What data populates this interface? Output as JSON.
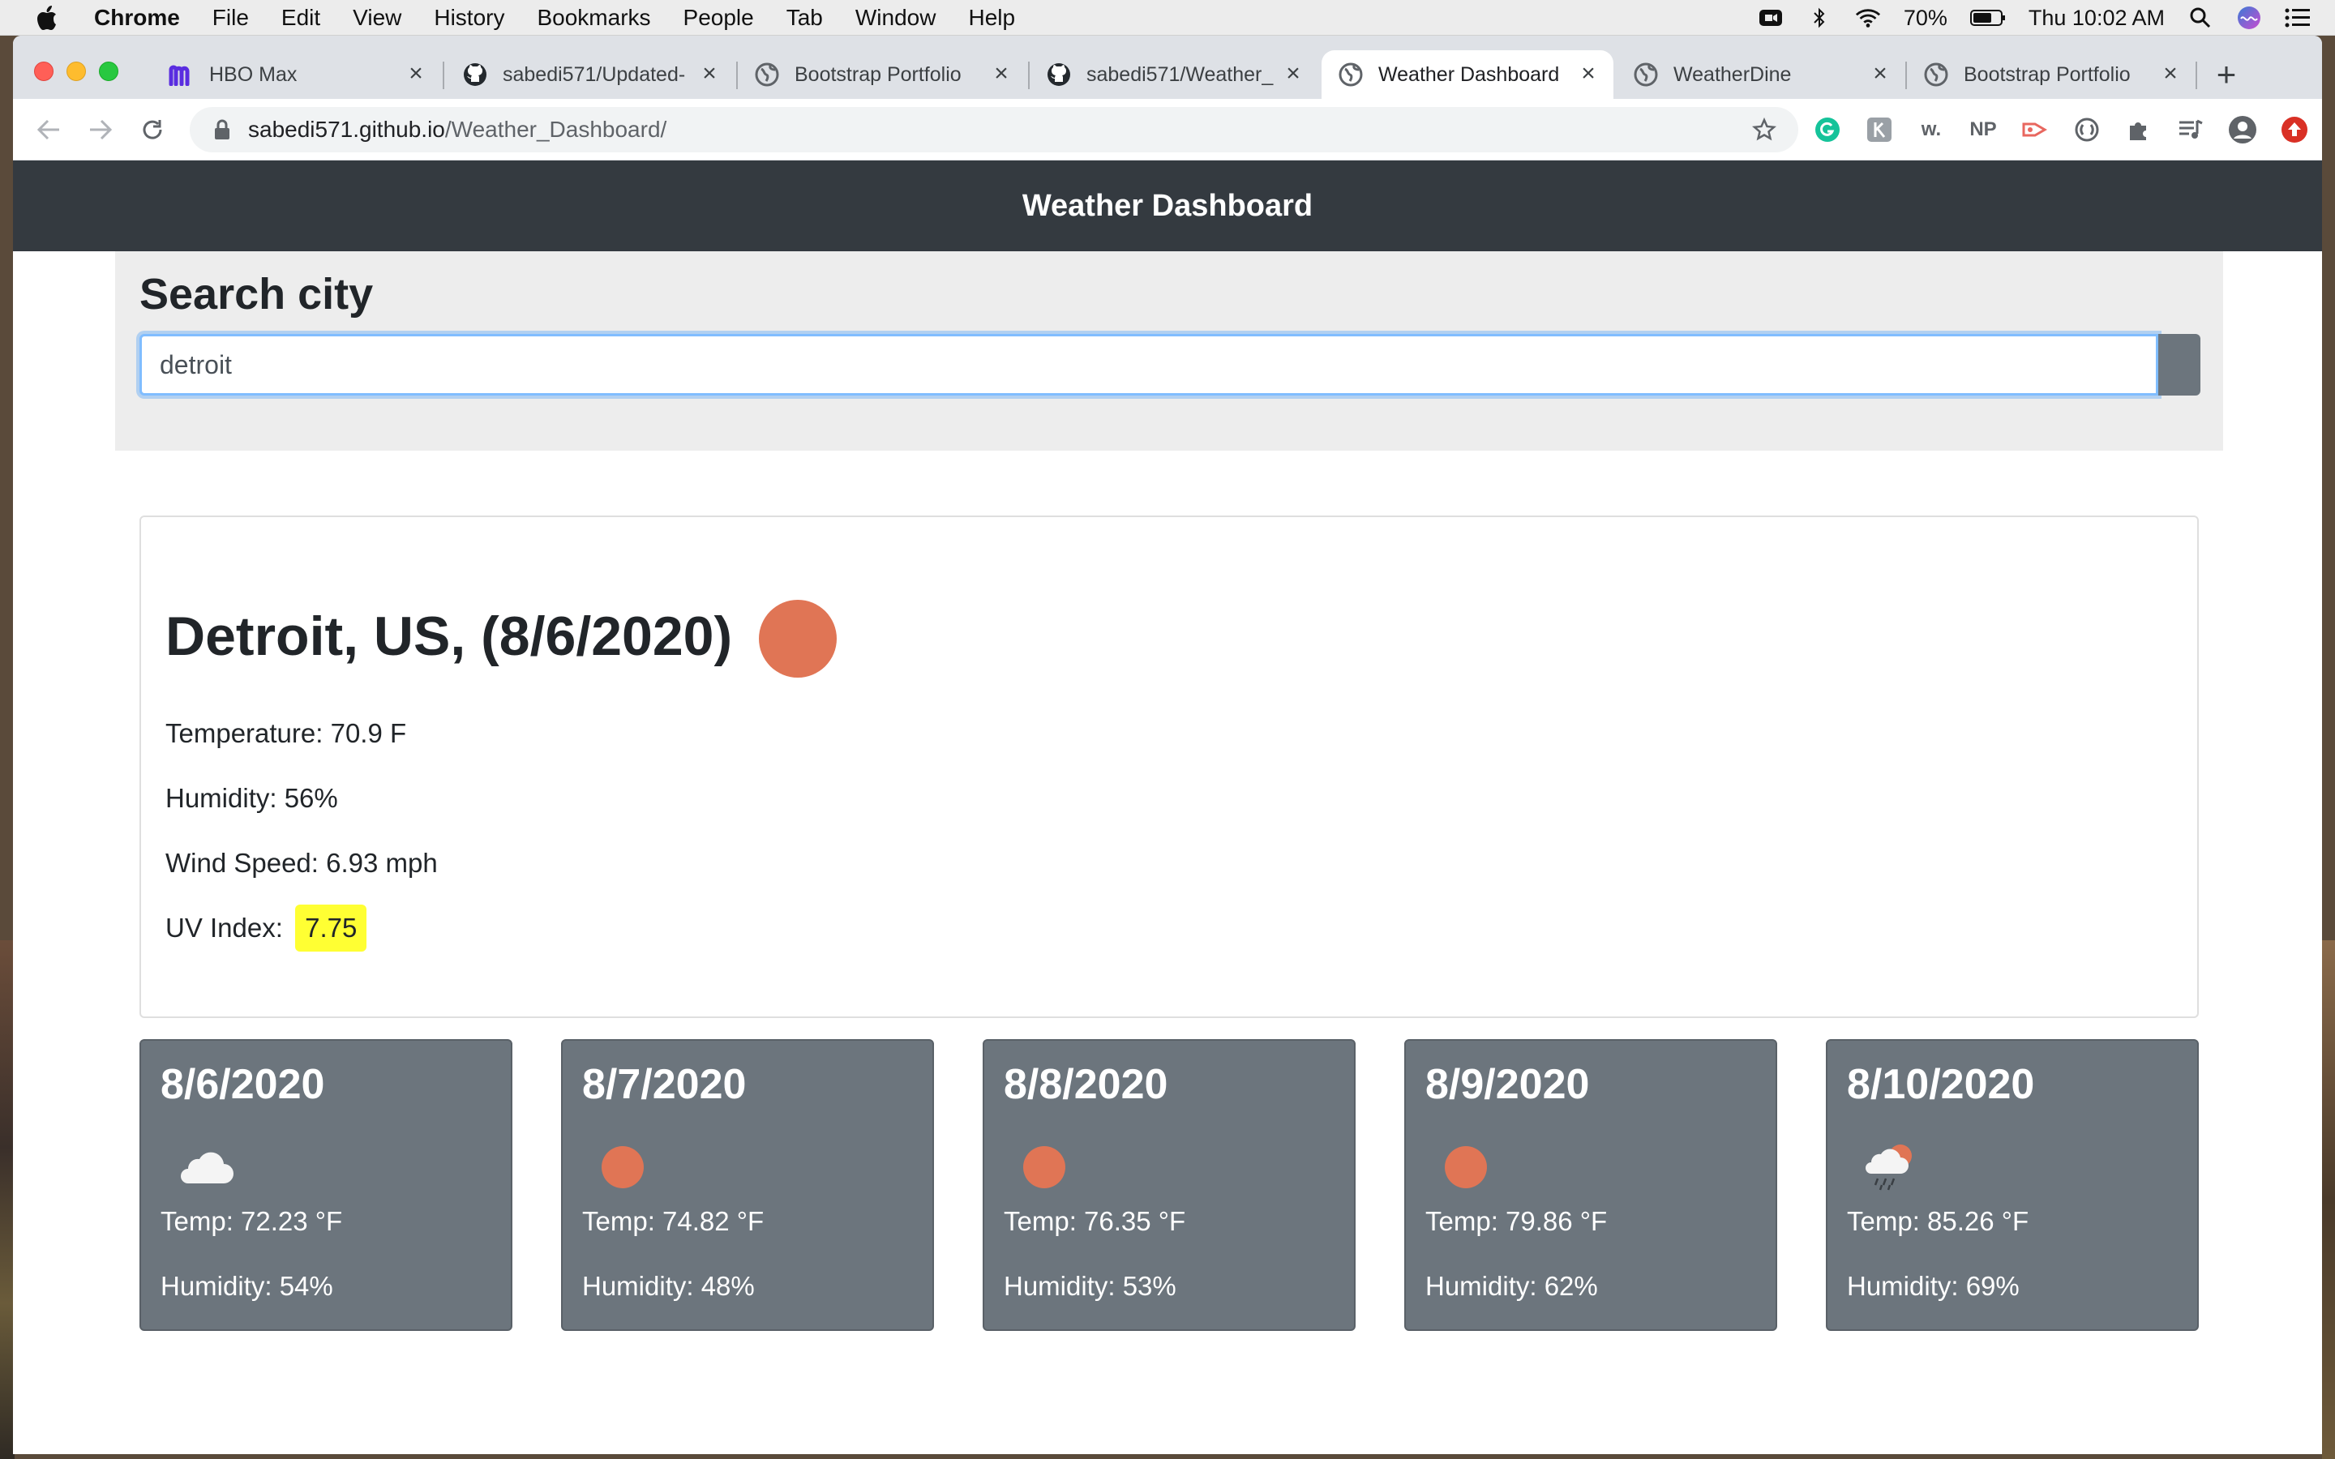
{
  "menubar": {
    "app": "Chrome",
    "items": [
      "File",
      "Edit",
      "View",
      "History",
      "Bookmarks",
      "People",
      "Tab",
      "Window",
      "Help"
    ],
    "battery": "70%",
    "clock": "Thu 10:02 AM"
  },
  "tabs": [
    {
      "title": "HBO Max",
      "icon": "hbo-max-icon"
    },
    {
      "title": "sabedi571/Updated-",
      "icon": "github-icon"
    },
    {
      "title": "Bootstrap Portfolio",
      "icon": "globe-icon"
    },
    {
      "title": "sabedi571/Weather_",
      "icon": "github-icon"
    },
    {
      "title": "Weather Dashboard",
      "icon": "globe-icon",
      "active": true
    },
    {
      "title": "WeatherDine",
      "icon": "globe-icon"
    },
    {
      "title": "Bootstrap Portfolio",
      "icon": "globe-icon"
    }
  ],
  "address": {
    "host": "sabedi571.github.io",
    "path": "/Weather_Dashboard/"
  },
  "extensions": [
    "grammarly-icon",
    "k-icon",
    "w-icon",
    "np-icon",
    "arrow-ext-icon",
    "circle-ext-icon",
    "puzzle-icon",
    "media-icon",
    "profile-icon",
    "update-icon"
  ],
  "ext_labels": {
    "w": "w.",
    "np": "NP"
  },
  "navbar": {
    "title": "Weather Dashboard"
  },
  "search": {
    "heading": "Search city",
    "value": "detroit"
  },
  "current": {
    "title": "Detroit, US, (8/6/2020)",
    "icon": "sun-icon",
    "temperature": "Temperature: 70.9 F",
    "humidity": "Humidity: 56%",
    "wind": "Wind Speed: 6.93 mph",
    "uv_label": "UV Index:",
    "uv_value": "7.75",
    "uv_color": "#ffff33"
  },
  "forecast": [
    {
      "date": "8/6/2020",
      "icon": "cloud-icon",
      "temp": "Temp: 72.23 °F",
      "humidity": "Humidity: 54%"
    },
    {
      "date": "8/7/2020",
      "icon": "sun-icon",
      "temp": "Temp: 74.82 °F",
      "humidity": "Humidity: 48%"
    },
    {
      "date": "8/8/2020",
      "icon": "sun-icon",
      "temp": "Temp: 76.35 °F",
      "humidity": "Humidity: 53%"
    },
    {
      "date": "8/9/2020",
      "icon": "sun-icon",
      "temp": "Temp: 79.86 °F",
      "humidity": "Humidity: 62%"
    },
    {
      "date": "8/10/2020",
      "icon": "rain-sun-icon",
      "temp": "Temp: 85.26 °F",
      "humidity": "Humidity: 69%"
    }
  ],
  "colors": {
    "navbar": "#343a40",
    "card": "#6c757d",
    "sun": "#e07555",
    "focus": "#80bdff"
  }
}
